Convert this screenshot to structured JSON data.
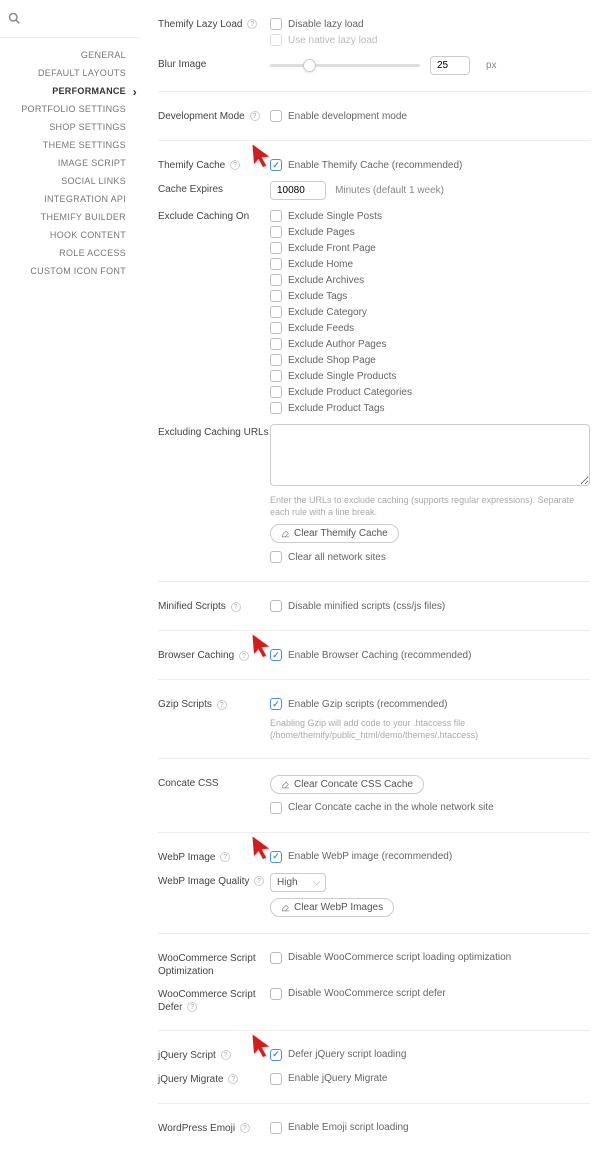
{
  "sidebar": {
    "items": [
      {
        "label": "GENERAL"
      },
      {
        "label": "DEFAULT LAYOUTS"
      },
      {
        "label": "PERFORMANCE",
        "active": true
      },
      {
        "label": "PORTFOLIO SETTINGS"
      },
      {
        "label": "SHOP SETTINGS"
      },
      {
        "label": "THEME SETTINGS"
      },
      {
        "label": "IMAGE SCRIPT"
      },
      {
        "label": "SOCIAL LINKS"
      },
      {
        "label": "INTEGRATION API"
      },
      {
        "label": "THEMIFY BUILDER"
      },
      {
        "label": "HOOK CONTENT"
      },
      {
        "label": "ROLE ACCESS"
      },
      {
        "label": "CUSTOM ICON FONT"
      }
    ]
  },
  "settings": {
    "lazy_load": {
      "label": "Themify Lazy Load",
      "disable": "Disable lazy load",
      "native": "Use native lazy load"
    },
    "blur": {
      "label": "Blur Image",
      "value": "25",
      "unit": "px"
    },
    "dev_mode": {
      "label": "Development Mode",
      "opt": "Enable development mode"
    },
    "cache": {
      "label": "Themify Cache",
      "opt": "Enable Themify Cache (recommended)"
    },
    "cache_expires": {
      "label": "Cache Expires",
      "value": "10080",
      "unit": "Minutes (default 1 week)"
    },
    "exclude_on": {
      "label": "Exclude Caching On",
      "opts": [
        "Exclude Single Posts",
        "Exclude Pages",
        "Exclude Front Page",
        "Exclude Home",
        "Exclude Archives",
        "Exclude Tags",
        "Exclude Category",
        "Exclude Feeds",
        "Exclude Author Pages",
        "Exclude Shop Page",
        "Exclude Single Products",
        "Exclude Product Categories",
        "Exclude Product Tags"
      ]
    },
    "exclude_urls": {
      "label": "Excluding Caching URLs",
      "hint": "Enter the URLs to exclude caching (supports regular expressions). Separate each rule with a line break."
    },
    "clear_cache_btn": "Clear Themify Cache",
    "clear_network": "Clear all network sites",
    "minified": {
      "label": "Minified Scripts",
      "opt": "Disable minified scripts (css/js files)"
    },
    "browser_caching": {
      "label": "Browser Caching",
      "opt": "Enable Browser Caching (recommended)"
    },
    "gzip": {
      "label": "Gzip Scripts",
      "opt": "Enable Gzip scripts (recommended)",
      "hint": "Enabling Gzip will add code to your .htaccess file (/home/themify/public_html/demo/themes/.htaccess)"
    },
    "concate": {
      "label": "Concate CSS",
      "btn": "Clear Concate CSS Cache",
      "net": "Clear Concate cache in the whole network site"
    },
    "webp": {
      "label": "WebP Image",
      "opt": "Enable WebP image (recommended)"
    },
    "webp_q": {
      "label": "WebP Image Quality",
      "value": "High",
      "btn": "Clear WebP Images"
    },
    "wc_opt": {
      "label": "WooCommerce Script Optimization",
      "opt": "Disable WooCommerce script loading optimization"
    },
    "wc_defer": {
      "label": "WooCommerce Script Defer",
      "opt": "Disable WooCommerce script defer"
    },
    "jquery": {
      "label": "jQuery Script",
      "opt": "Defer jQuery script loading"
    },
    "jquery_migrate": {
      "label": "jQuery Migrate",
      "opt": "Enable jQuery Migrate"
    },
    "emoji": {
      "label": "WordPress Emoji",
      "opt": "Enable Emoji script loading"
    }
  }
}
